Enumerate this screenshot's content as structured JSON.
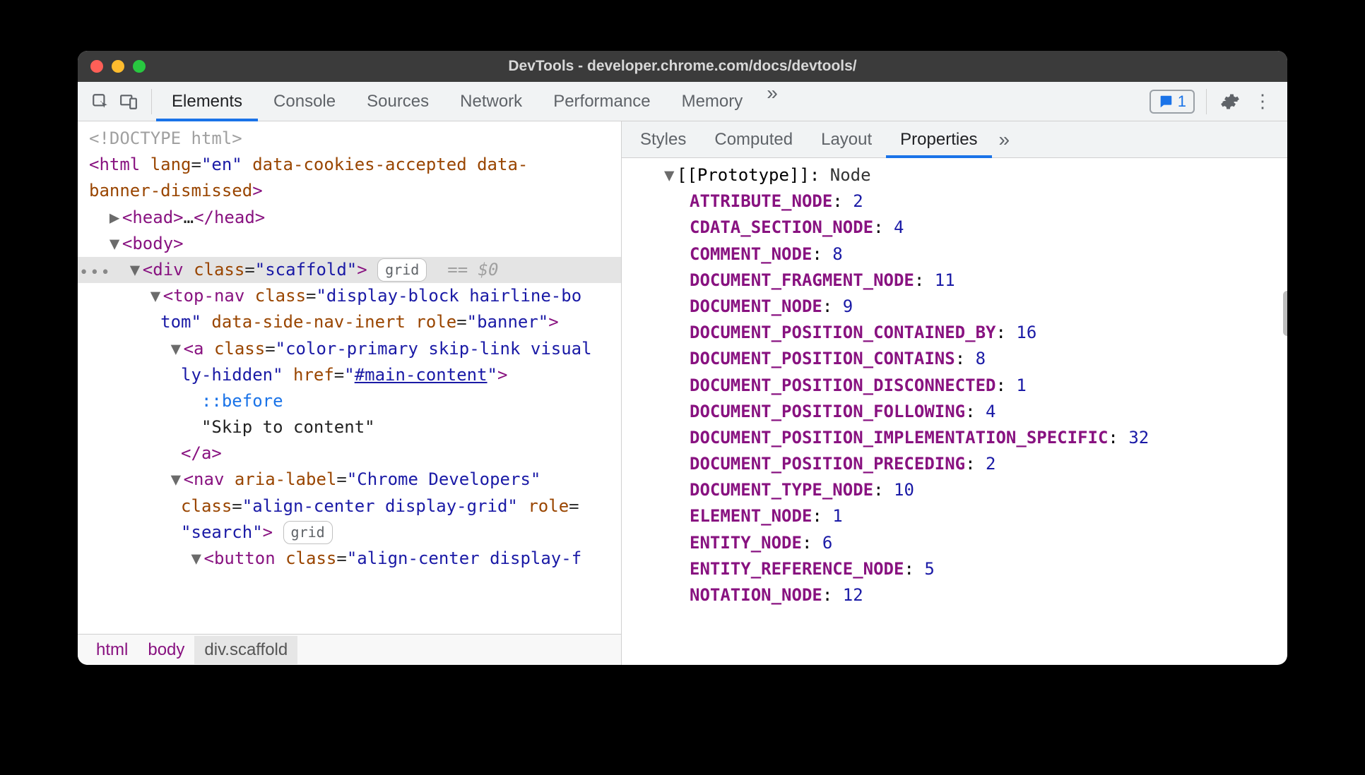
{
  "window": {
    "title": "DevTools - developer.chrome.com/docs/devtools/"
  },
  "toolbar": {
    "tabs": [
      "Elements",
      "Console",
      "Sources",
      "Network",
      "Performance",
      "Memory"
    ],
    "active_tab_index": 0,
    "issues_count": "1"
  },
  "elements_tree": {
    "doctype": "<!DOCTYPE html>",
    "html_open": {
      "tag": "html",
      "attrs_text": "lang=\"en\" data-cookies-accepted data-banner-dismissed"
    },
    "head": {
      "open": "<head>",
      "ellipsis": "…",
      "close": "</head>"
    },
    "body_open": "<body>",
    "selected": {
      "open": "<div ",
      "class_attr": "class=\"scaffold\"",
      "close": ">",
      "badge": "grid",
      "eq0": "== $0"
    },
    "topnav": {
      "line1": "<top-nav class=\"display-block hairline-bo",
      "line2": "tom\" data-side-nav-inert role=\"banner\">"
    },
    "anchor": {
      "line1": "<a class=\"color-primary skip-link visual",
      "line2_pre": "ly-hidden\" href=\"",
      "href": "#main-content",
      "line2_post": "\">",
      "pseudo": "::before",
      "text": "\"Skip to content\"",
      "close": "</a>"
    },
    "nav": {
      "line1": "<nav aria-label=\"Chrome Developers\"",
      "line2": "class=\"align-center display-grid\" role=",
      "line3_pre": "\"search\"> ",
      "badge": "grid"
    },
    "button": {
      "line1": "<button class=\"align-center display-f"
    }
  },
  "breadcrumbs": [
    "html",
    "body",
    "div.scaffold"
  ],
  "sidebar": {
    "tabs": [
      "Styles",
      "Computed",
      "Layout",
      "Properties"
    ],
    "active_tab_index": 3,
    "prototype_label": "[[Prototype]]",
    "prototype_value": "Node",
    "properties": [
      {
        "key": "ATTRIBUTE_NODE",
        "val": "2"
      },
      {
        "key": "CDATA_SECTION_NODE",
        "val": "4"
      },
      {
        "key": "COMMENT_NODE",
        "val": "8"
      },
      {
        "key": "DOCUMENT_FRAGMENT_NODE",
        "val": "11"
      },
      {
        "key": "DOCUMENT_NODE",
        "val": "9"
      },
      {
        "key": "DOCUMENT_POSITION_CONTAINED_BY",
        "val": "16"
      },
      {
        "key": "DOCUMENT_POSITION_CONTAINS",
        "val": "8"
      },
      {
        "key": "DOCUMENT_POSITION_DISCONNECTED",
        "val": "1"
      },
      {
        "key": "DOCUMENT_POSITION_FOLLOWING",
        "val": "4"
      },
      {
        "key": "DOCUMENT_POSITION_IMPLEMENTATION_SPECIFIC",
        "val": "32"
      },
      {
        "key": "DOCUMENT_POSITION_PRECEDING",
        "val": "2"
      },
      {
        "key": "DOCUMENT_TYPE_NODE",
        "val": "10"
      },
      {
        "key": "ELEMENT_NODE",
        "val": "1"
      },
      {
        "key": "ENTITY_NODE",
        "val": "6"
      },
      {
        "key": "ENTITY_REFERENCE_NODE",
        "val": "5"
      },
      {
        "key": "NOTATION_NODE",
        "val": "12"
      }
    ]
  }
}
